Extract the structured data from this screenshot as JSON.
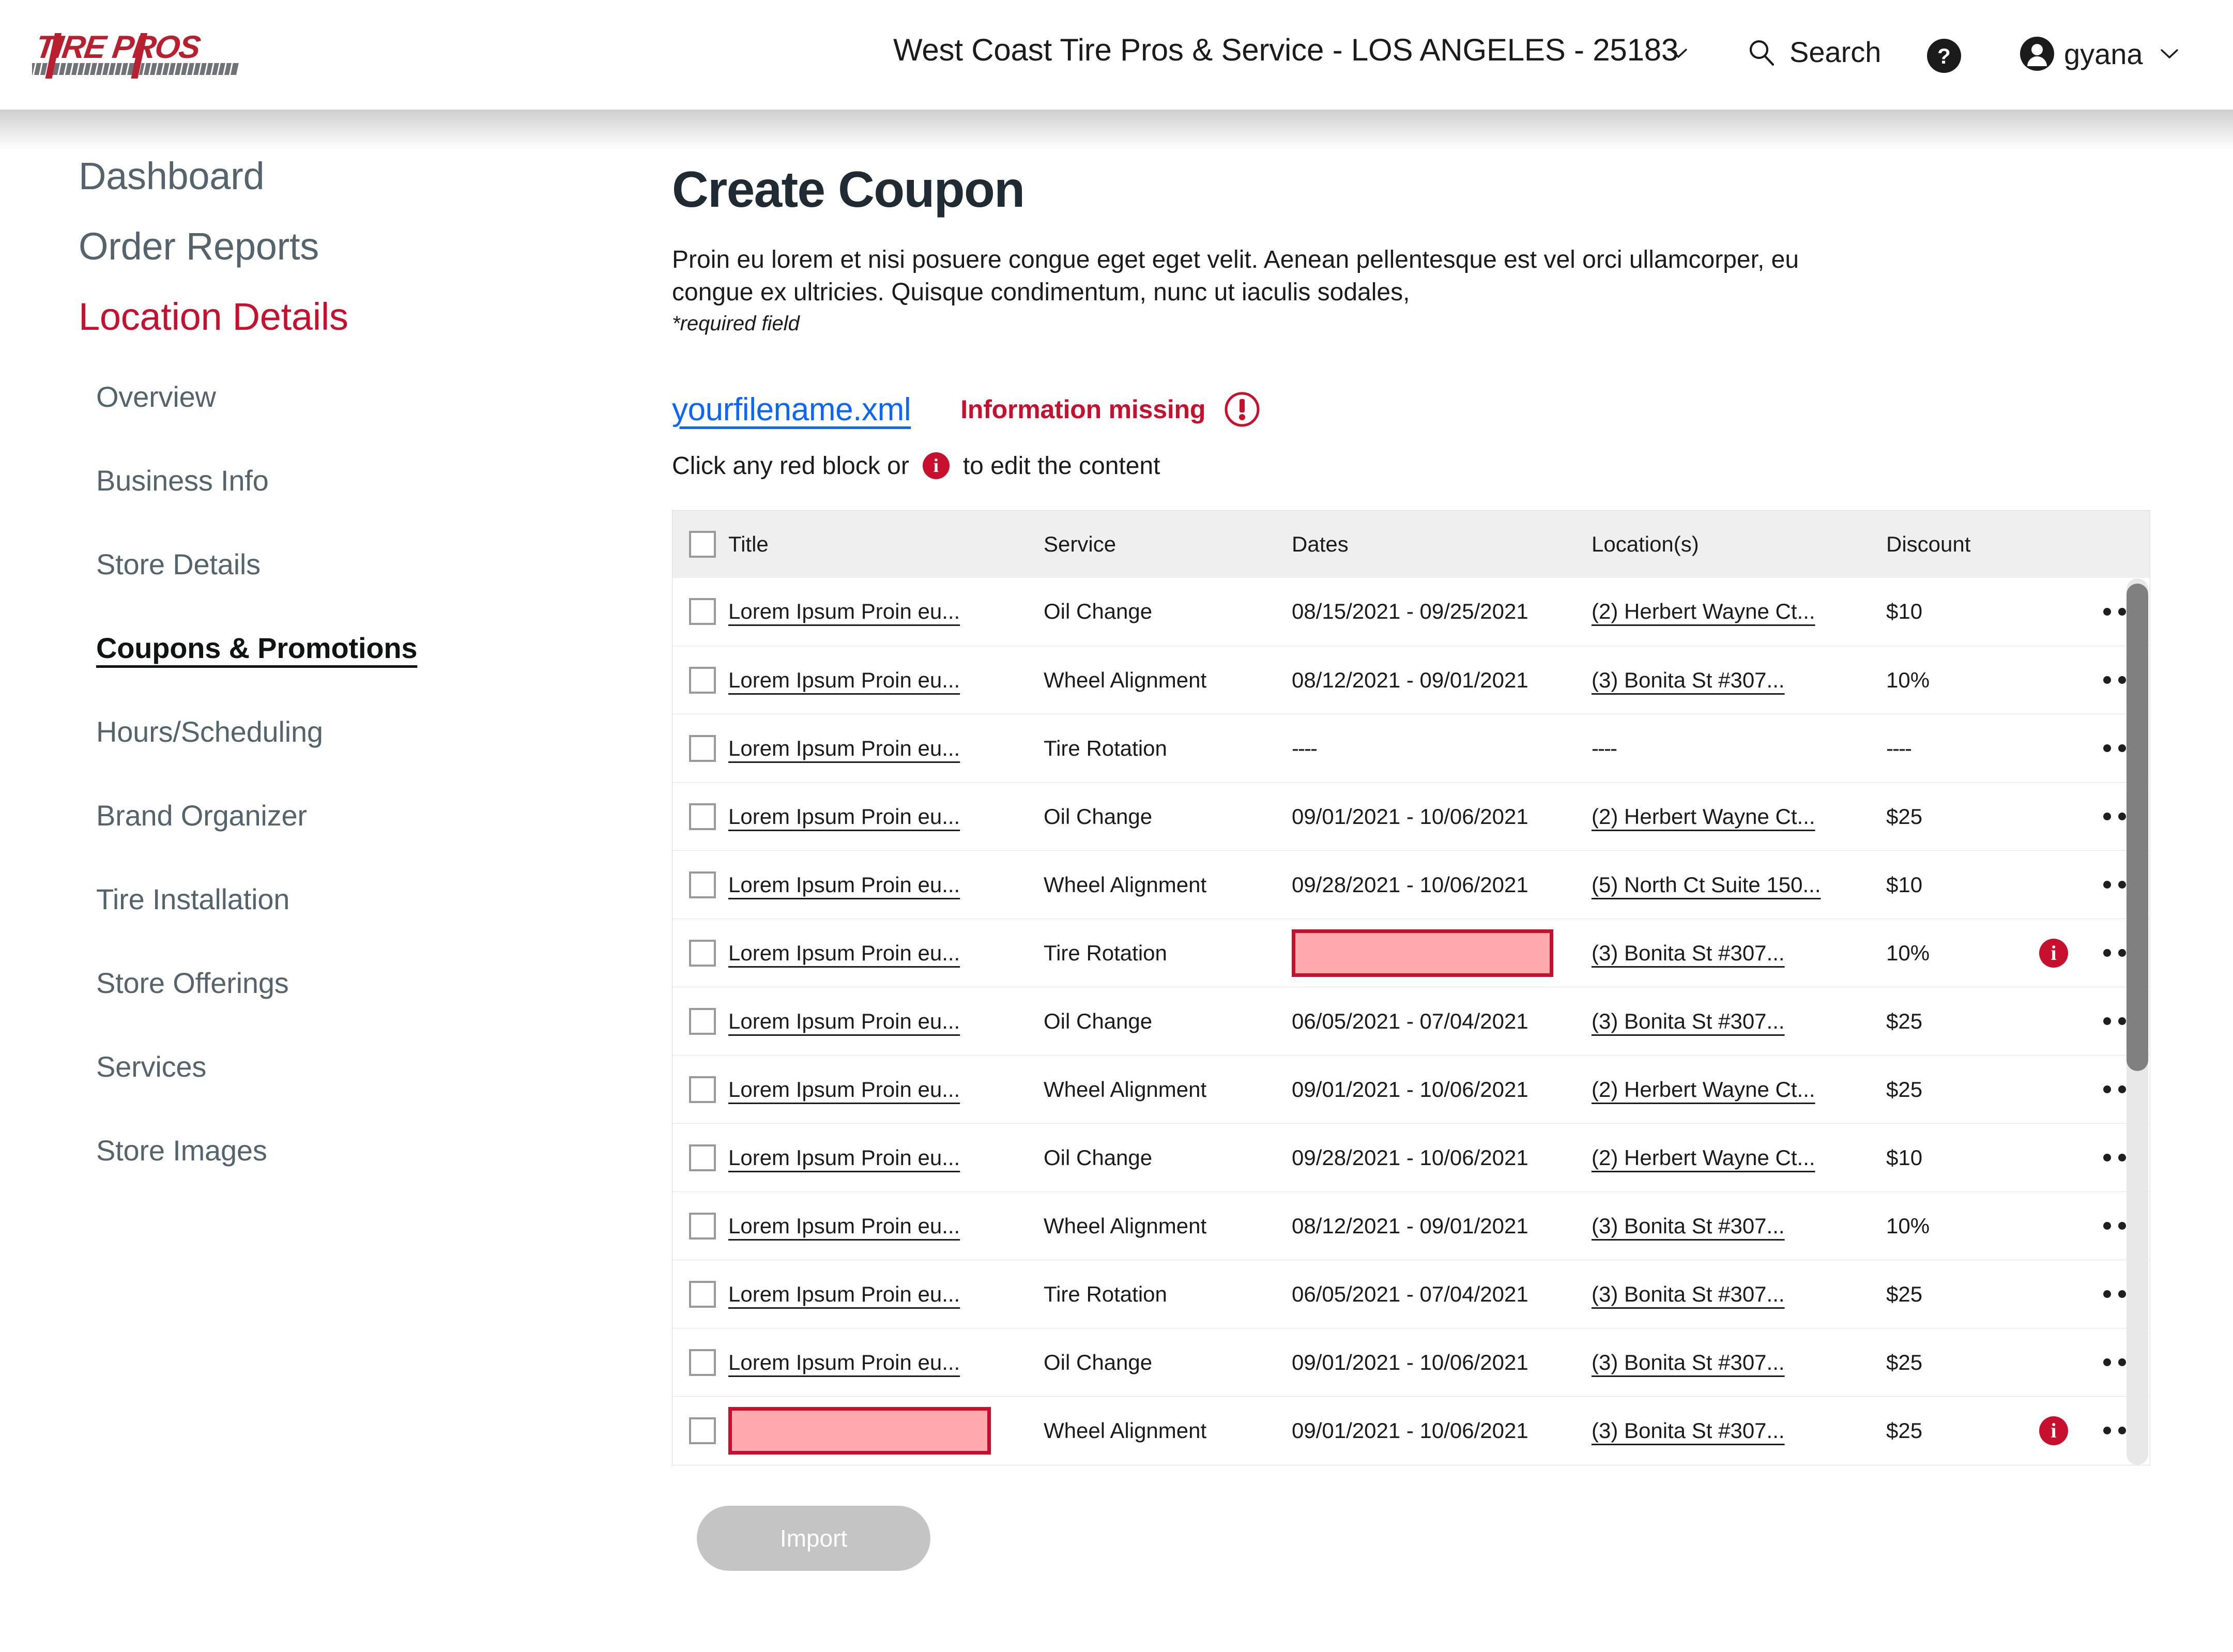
{
  "header": {
    "logo_text_top": "TIRE PROS",
    "store_selector": "West Coast Tire Pros & Service - LOS ANGELES - 25183",
    "search_label": "Search",
    "help_label": "?",
    "user_name": "gyana"
  },
  "sidebar": {
    "top_items": [
      {
        "label": "Dashboard",
        "active": false
      },
      {
        "label": "Order Reports",
        "active": false
      },
      {
        "label": "Location Details",
        "active": true
      }
    ],
    "sub_items": [
      {
        "label": "Overview",
        "current": false
      },
      {
        "label": "Business Info",
        "current": false
      },
      {
        "label": "Store Details",
        "current": false
      },
      {
        "label": "Coupons & Promotions",
        "current": true
      },
      {
        "label": "Hours/Scheduling",
        "current": false
      },
      {
        "label": "Brand Organizer",
        "current": false
      },
      {
        "label": "Tire Installation",
        "current": false
      },
      {
        "label": "Store Offerings",
        "current": false
      },
      {
        "label": "Services",
        "current": false
      },
      {
        "label": "Store Images",
        "current": false
      }
    ]
  },
  "main": {
    "title": "Create Coupon",
    "description": "Proin eu lorem et nisi posuere congue eget eget velit. Aenean pellentesque est vel orci ullamcorper, eu congue ex ultricies. Quisque condimentum, nunc ut iaculis sodales,",
    "required_note": "*required field",
    "file_name": "yourfilename.xml",
    "warning_text": "Information missing",
    "hint_prefix": "Click any red block or",
    "hint_suffix": "to edit the content",
    "info_glyph": "i",
    "import_label": "Import"
  },
  "table": {
    "columns": [
      "Title",
      "Service",
      "Dates",
      "Location(s)",
      "Discount"
    ],
    "rows": [
      {
        "title": "Lorem Ipsum Proin eu...",
        "title_missing": false,
        "service": "Oil Change",
        "dates": "08/15/2021 - 09/25/2021",
        "dates_missing": false,
        "location": "(2) Herbert Wayne Ct...",
        "discount": "$10",
        "has_info": false
      },
      {
        "title": "Lorem Ipsum Proin eu...",
        "title_missing": false,
        "service": "Wheel Alignment",
        "dates": "08/12/2021 - 09/01/2021",
        "dates_missing": false,
        "location": "(3) Bonita St #307...",
        "discount": "10%",
        "has_info": false
      },
      {
        "title": "Lorem Ipsum Proin eu...",
        "title_missing": false,
        "service": "Tire Rotation",
        "dates": "----",
        "dates_missing": false,
        "location": "----",
        "discount": "----",
        "has_info": false
      },
      {
        "title": "Lorem Ipsum Proin eu...",
        "title_missing": false,
        "service": "Oil Change",
        "dates": "09/01/2021 - 10/06/2021",
        "dates_missing": false,
        "location": "(2) Herbert Wayne Ct...",
        "discount": "$25",
        "has_info": false
      },
      {
        "title": "Lorem Ipsum Proin eu...",
        "title_missing": false,
        "service": "Wheel Alignment",
        "dates": "09/28/2021 - 10/06/2021",
        "dates_missing": false,
        "location": "(5) North Ct Suite 150...",
        "discount": "$10",
        "has_info": false
      },
      {
        "title": "Lorem Ipsum Proin eu...",
        "title_missing": false,
        "service": "Tire Rotation",
        "dates": "",
        "dates_missing": true,
        "location": "(3) Bonita St #307...",
        "discount": "10%",
        "has_info": true
      },
      {
        "title": "Lorem Ipsum Proin eu...",
        "title_missing": false,
        "service": "Oil Change",
        "dates": "06/05/2021 - 07/04/2021",
        "dates_missing": false,
        "location": "(3) Bonita St #307...",
        "discount": "$25",
        "has_info": false
      },
      {
        "title": "Lorem Ipsum Proin eu...",
        "title_missing": false,
        "service": "Wheel Alignment",
        "dates": "09/01/2021 - 10/06/2021",
        "dates_missing": false,
        "location": "(2) Herbert Wayne Ct...",
        "discount": "$25",
        "has_info": false
      },
      {
        "title": "Lorem Ipsum Proin eu...",
        "title_missing": false,
        "service": "Oil Change",
        "dates": "09/28/2021 - 10/06/2021",
        "dates_missing": false,
        "location": "(2) Herbert Wayne Ct...",
        "discount": "$10",
        "has_info": false
      },
      {
        "title": "Lorem Ipsum Proin eu...",
        "title_missing": false,
        "service": "Wheel Alignment",
        "dates": "08/12/2021 - 09/01/2021",
        "dates_missing": false,
        "location": "(3) Bonita St #307...",
        "discount": "10%",
        "has_info": false
      },
      {
        "title": "Lorem Ipsum Proin eu...",
        "title_missing": false,
        "service": "Tire Rotation",
        "dates": "06/05/2021 - 07/04/2021",
        "dates_missing": false,
        "location": "(3) Bonita St #307...",
        "discount": "$25",
        "has_info": false
      },
      {
        "title": "Lorem Ipsum Proin eu...",
        "title_missing": false,
        "service": "Oil Change",
        "dates": "09/01/2021 - 10/06/2021",
        "dates_missing": false,
        "location": "(3) Bonita St #307...",
        "discount": "$25",
        "has_info": false
      },
      {
        "title": "",
        "title_missing": true,
        "service": "Wheel Alignment",
        "dates": "09/01/2021 - 10/06/2021",
        "dates_missing": false,
        "location": "(3) Bonita St #307...",
        "discount": "$25",
        "has_info": true
      }
    ]
  },
  "colors": {
    "brand_red": "#C8102E",
    "link_blue": "#0b66ff",
    "nav_grey": "#55636d",
    "missing_fill": "#FFAAAD"
  }
}
